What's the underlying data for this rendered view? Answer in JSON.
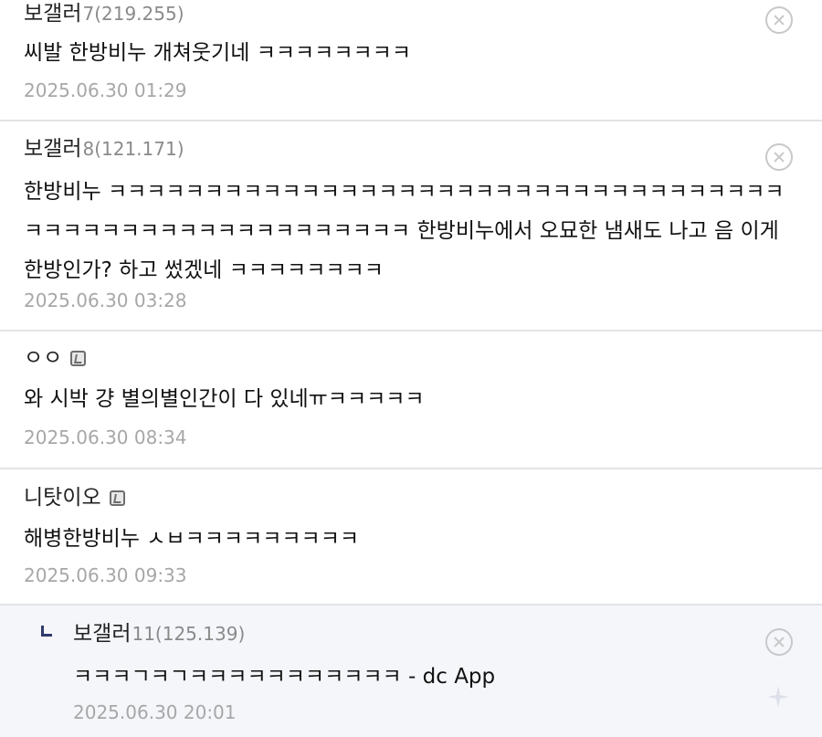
{
  "comments": [
    {
      "author": "보갤러",
      "ip": "7(219.255)",
      "text": "씨발 한방비누 개쳐웃기네 ㅋㅋㅋㅋㅋㅋㅋㅋ",
      "date": "2025.06.30 01:29",
      "fixed_badge": false,
      "deletable": true
    },
    {
      "author": "보갤러",
      "ip": "8(121.171)",
      "text": "한방비누 ㅋㅋㅋㅋㅋㅋㅋㅋㅋㅋㅋㅋㅋㅋㅋㅋㅋㅋㅋㅋㅋㅋㅋㅋㅋㅋㅋㅋㅋㅋㅋㅋㅋㅋㅋㅋㅋㅋㅋㅋㅋㅋㅋㅋㅋㅋㅋㅋㅋㅋㅋㅋㅋㅋㅋ 한방비누에서 오묘한 냄새도 나고 음 이게 한방인가? 하고 썼겠네 ㅋㅋㅋㅋㅋㅋㅋㅋ",
      "date": "2025.06.30 03:28",
      "fixed_badge": false,
      "deletable": true
    },
    {
      "author": "ㅇㅇ",
      "ip": "",
      "text": "와 시박 걍 별의별인간이 다 있네ㅠㅋㅋㅋㅋㅋ",
      "date": "2025.06.30 08:34",
      "fixed_badge": true,
      "deletable": false
    },
    {
      "author": "니탓이오",
      "ip": "",
      "text": "해병한방비누 ㅅㅂㅋㅋㅋㅋㅋㅋㅋㅋㅋ",
      "date": "2025.06.30 09:33",
      "fixed_badge": true,
      "deletable": false
    }
  ],
  "reply": {
    "author": "보갤러",
    "ip": "11(125.139)",
    "text": "ㅋㅋㅋㄱㅋㄱㅋㅋㅋㅋㅋㅋㅋㅋㅋㅋㅋ - dc App",
    "date": "2025.06.30 20:01",
    "deletable": true
  },
  "icons": {
    "delete": "close-circle-icon",
    "fixed_user": "fixed-nick-icon",
    "reply": "reply-arrow-icon"
  },
  "colors": {
    "reply_background": "#f4f6fa",
    "ip_text": "#8a8a8a",
    "date_text": "#a7a7a7",
    "reply_arrow": "#2f3a6b"
  }
}
